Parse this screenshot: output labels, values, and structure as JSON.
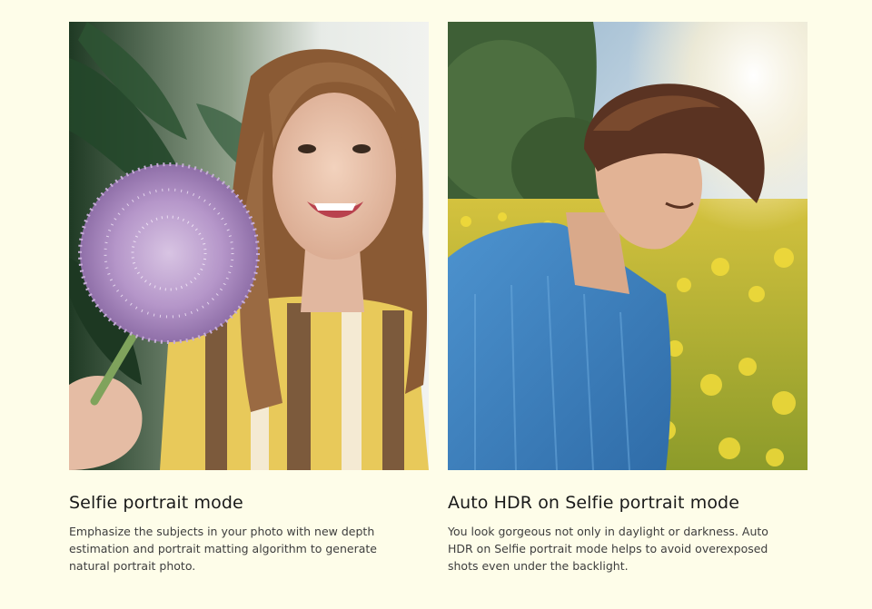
{
  "sections": [
    {
      "title": "Selfie portrait mode",
      "description_lines": [
        "Emphasize the subjects in your photo with new depth",
        "estimation and portrait matting algorithm to generate",
        "natural portrait photo."
      ]
    },
    {
      "title": "Auto HDR on Selfie portrait mode",
      "description_lines": [
        "You look gorgeous not only in daylight or darkness. Auto",
        "HDR on Selfie portrait mode helps to avoid overexposed",
        "shots even under the backlight."
      ]
    }
  ],
  "colors": {
    "page_background": "#fefde9",
    "title_text": "#1a1a1a",
    "body_text": "#3d3d3d"
  }
}
